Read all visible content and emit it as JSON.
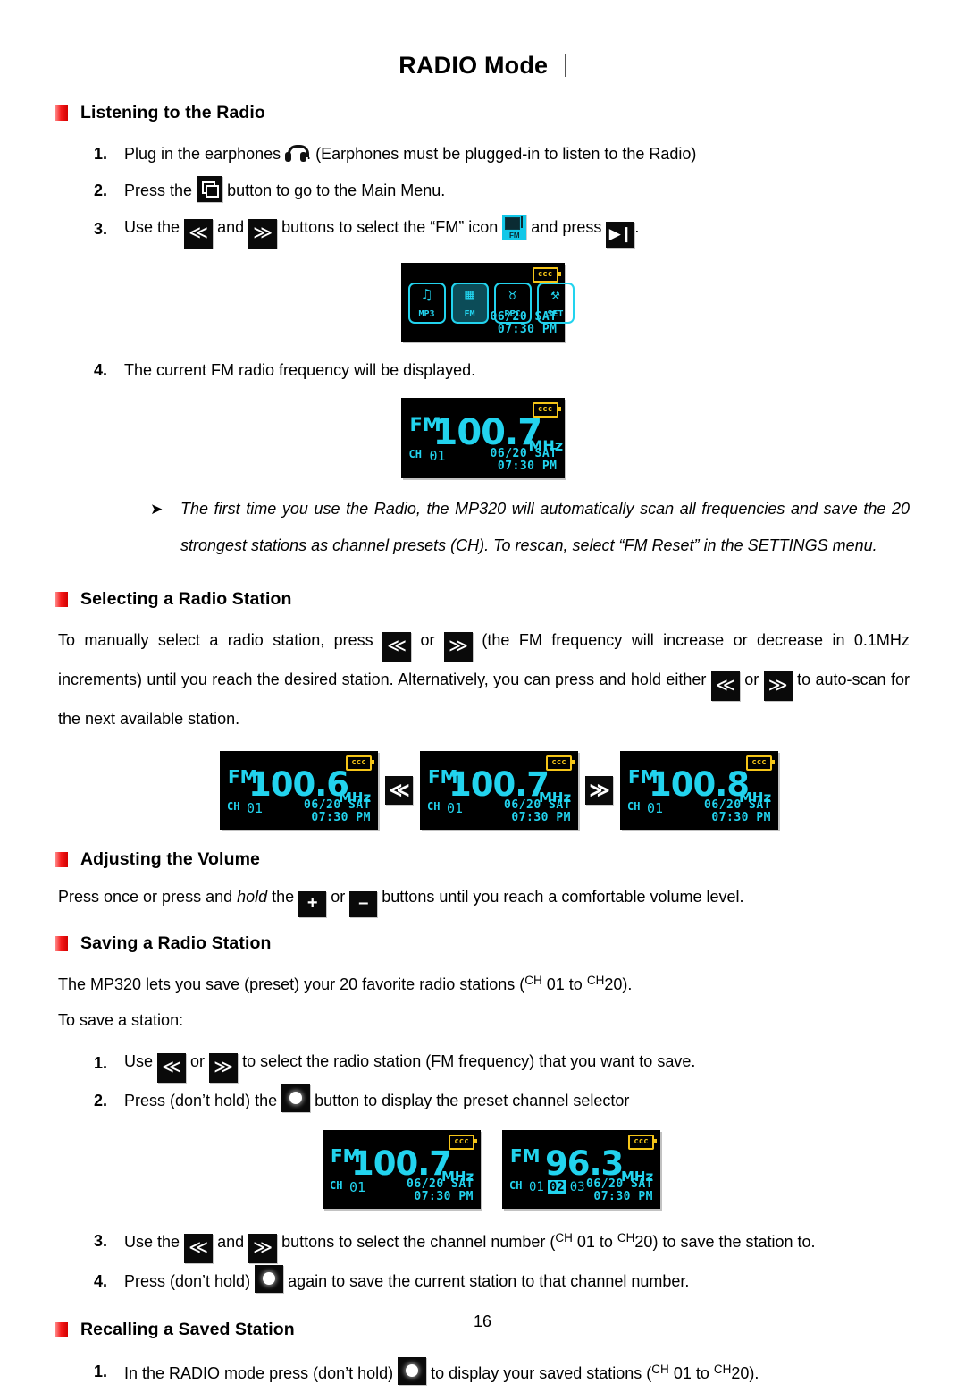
{
  "page": {
    "title": "RADIO Mode",
    "page_number": "16"
  },
  "sections": {
    "listening": {
      "heading": "Listening to the Radio",
      "steps": [
        {
          "num": "1.",
          "before": "Plug in the earphones",
          "after": ". (Earphones must be plugged-in to listen to the Radio)"
        },
        {
          "num": "2.",
          "before": "Press the",
          "after": "button to go to the Main Menu."
        },
        {
          "num": "3.",
          "a": "Use the",
          "b": "and",
          "c": "buttons to select the “FM” icon",
          "d": "and press",
          "e": "."
        },
        {
          "num": "4.",
          "text": "The current FM radio frequency will be displayed."
        }
      ],
      "note": "The first time you use the Radio, the MP320 will automatically scan all frequencies and save the 20 strongest stations as channel presets (CH). To rescan, select “FM Reset” in the SETTINGS menu.",
      "note_bullet": "➤"
    },
    "selecting": {
      "heading": "Selecting a Radio Station",
      "p1": "To manually select a radio station, press",
      "p2": "or",
      "p3": "(the FM frequency will increase or decrease in 0.1MHz increments) until you reach the desired station. Alternatively, you can press and hold either",
      "p4": "or",
      "p5": "to auto-scan for the next available station."
    },
    "volume": {
      "heading": "Adjusting the Volume",
      "p1": "Press once or press and",
      "p1_italic": "hold",
      "p2": "the",
      "p3": "or",
      "p4": "buttons until you reach a comfortable volume level."
    },
    "saving": {
      "heading": "Saving a Radio Station",
      "intro_a": "The MP320 lets you save (preset) your 20 favorite radio stations (",
      "intro_ch1": "CH",
      "intro_n1": "01 to",
      "intro_ch2": "CH",
      "intro_n2": "20).",
      "intro2": "To save a station:",
      "steps": [
        {
          "num": "1.",
          "a": "Use",
          "b": "or",
          "c": "to select the radio station (FM frequency) that you want to save."
        },
        {
          "num": "2.",
          "a": "Press (don’t hold) the",
          "b": "button to display the preset channel selector"
        },
        {
          "num": "3.",
          "a": "Use the",
          "b": "and",
          "c": "buttons to select the channel number (",
          "ch1": "CH",
          "n1": "01 to",
          "ch2": "CH",
          "n2": "20) to save the station to."
        },
        {
          "num": "4.",
          "a": "Press (don’t hold)",
          "b": "again to save the current station to that channel number."
        }
      ]
    },
    "recalling": {
      "heading": "Recalling a Saved Station",
      "steps": [
        {
          "num": "1.",
          "a": "In the RADIO mode press (don’t hold)",
          "b": "to display your saved stations (",
          "ch1": "CH",
          "n1": "01 to",
          "ch2": "CH",
          "n2": "20)."
        }
      ]
    }
  },
  "buttons": {
    "prev_glyph": "≪",
    "next_glyph": "≫",
    "play_glyph": "▶❙",
    "plus_glyph": "+",
    "minus_glyph": "–",
    "fm_icon_label": "FM",
    "colors": {
      "accent_red": "#f41b1b",
      "lcd_cyan": "#22d3ee",
      "battery_yellow": "#f5c518",
      "lcd_bg": "#000000"
    }
  },
  "screens": {
    "main_menu": {
      "battery": "ccc",
      "items": [
        {
          "glyph": "♫",
          "cap": "MP3",
          "selected": false
        },
        {
          "glyph": "▦",
          "cap": "FM",
          "selected": true
        },
        {
          "glyph": "♉",
          "cap": "REC",
          "selected": false
        },
        {
          "glyph": "⚒",
          "cap": "SET",
          "selected": false
        }
      ],
      "date": "06/20 SAT",
      "time": "07:30 PM"
    },
    "fm_main": {
      "battery": "ccc",
      "fm": "FM",
      "freq": "100.7",
      "unit": "MHz",
      "ch_label": "CH",
      "ch_num": "01",
      "date": "06/20 SAT",
      "time": "07:30 PM"
    },
    "tuning": [
      {
        "battery": "ccc",
        "fm": "FM",
        "freq": "100.6",
        "unit": "MHz",
        "ch_label": "CH",
        "ch_num": "01",
        "date": "06/20 SAT",
        "time": "07:30 PM"
      },
      {
        "battery": "ccc",
        "fm": "FM",
        "freq": "100.7",
        "unit": "MHz",
        "ch_label": "CH",
        "ch_num": "01",
        "date": "06/20 SAT",
        "time": "07:30 PM"
      },
      {
        "battery": "ccc",
        "fm": "FM",
        "freq": "100.8",
        "unit": "MHz",
        "ch_label": "CH",
        "ch_num": "01",
        "date": "06/20 SAT",
        "time": "07:30 PM"
      }
    ],
    "tuning_arrows": {
      "left": "≪",
      "right": "≫"
    },
    "preset": [
      {
        "battery": "ccc",
        "fm": "FM",
        "freq": "100.7",
        "unit": "MHz",
        "ch_label": "CH",
        "ch_num": "01",
        "date": "06/20 SAT",
        "time": "07:30 PM"
      },
      {
        "battery": "ccc",
        "fm": "FM",
        "freq": "96.3",
        "unit": "MHz",
        "ch_label": "CH",
        "ch_a": "01",
        "ch_b": "02",
        "ch_c": "03",
        "date": "06/20 SAT",
        "time": "07:30 PM"
      }
    ]
  }
}
